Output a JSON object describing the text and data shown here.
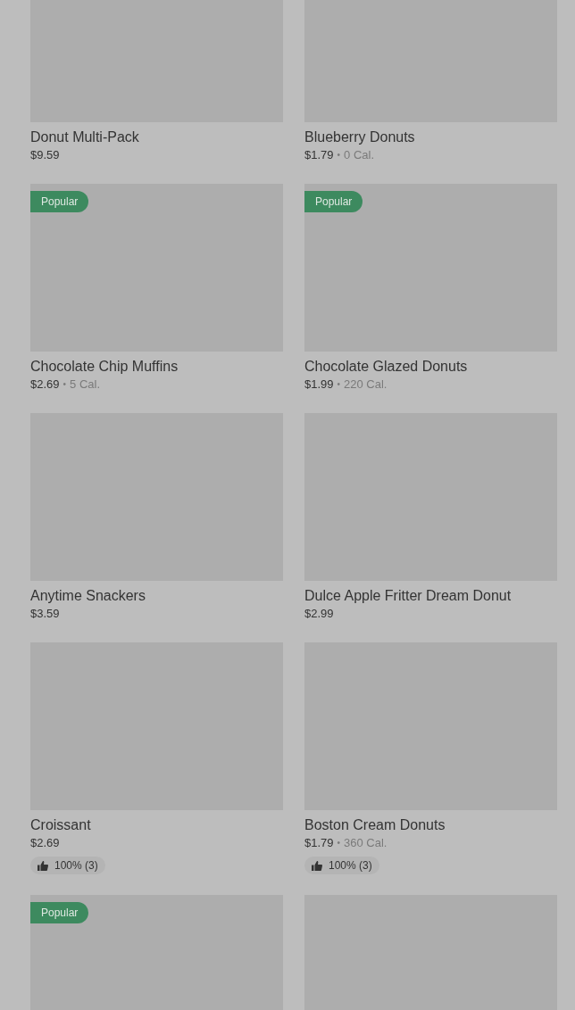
{
  "items": [
    {
      "name": "Donut Multi-Pack",
      "price": "$9.59",
      "popular": false
    },
    {
      "name": "Blueberry Donuts",
      "price": "$1.79",
      "separator": "•",
      "calories": "0 Cal.",
      "popular": false
    },
    {
      "badge": "Popular",
      "name": "Chocolate Chip Muffins",
      "price": "$2.69",
      "separator": "•",
      "calories": "5 Cal.",
      "popular": true
    },
    {
      "badge": "Popular",
      "name": "Chocolate Glazed Donuts",
      "price": "$1.99",
      "separator": "•",
      "calories": "220 Cal.",
      "popular": true
    },
    {
      "name": "Anytime Snackers",
      "price": "$3.59",
      "popular": false
    },
    {
      "name": "Dulce Apple Fritter Dream Donut",
      "price": "$2.99",
      "popular": false
    },
    {
      "name": "Croissant",
      "price": "$2.69",
      "rating": "100% (3)",
      "popular": false
    },
    {
      "name": "Boston Cream Donuts",
      "price": "$1.79",
      "separator": "•",
      "calories": "360 Cal.",
      "rating": "100% (3)",
      "popular": false
    },
    {
      "badge": "Popular",
      "popular": true
    },
    {
      "popular": false
    }
  ]
}
